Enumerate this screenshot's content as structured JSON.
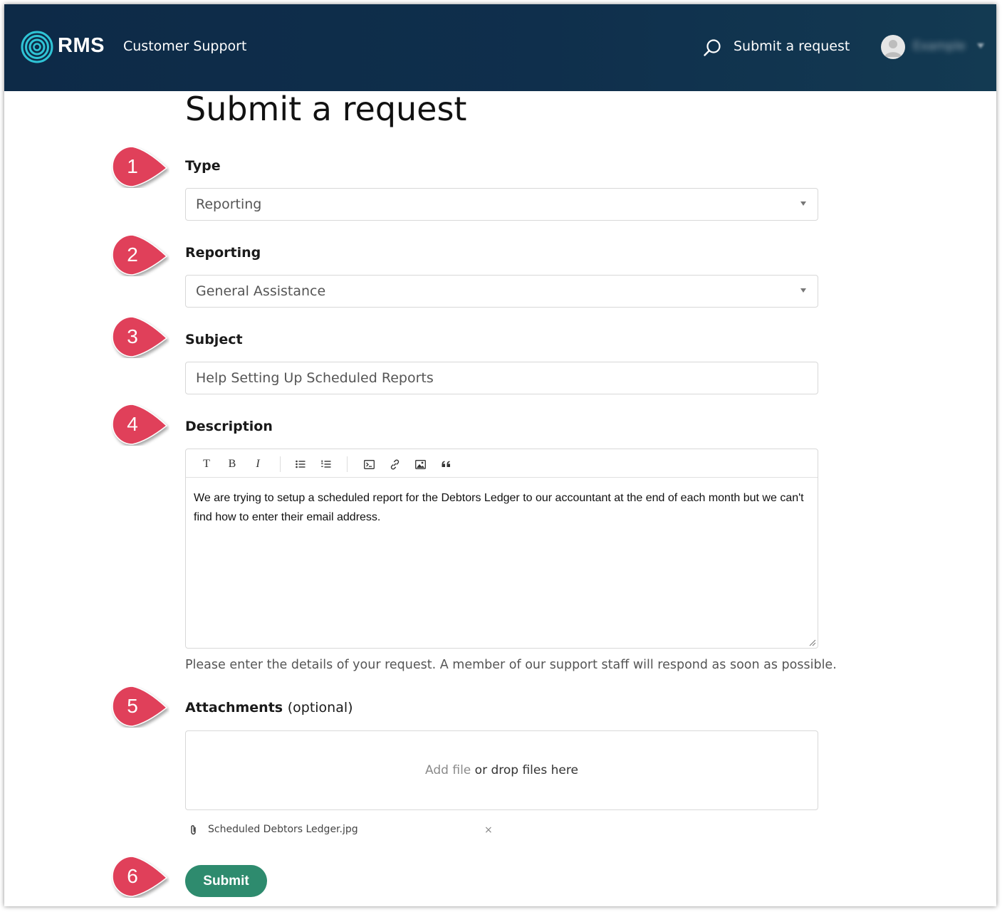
{
  "header": {
    "logo_text": "RMS",
    "site_title": "Customer Support",
    "submit_link": "Submit a request",
    "user_name": "Example",
    "icons": {
      "search": "search-icon",
      "user": "user-avatar-icon",
      "caret": "chevron-down-icon"
    },
    "colors": {
      "background": "#0f2f4c",
      "logo_ring": "#2fc4d6"
    }
  },
  "page": {
    "title": "Submit a request"
  },
  "form": {
    "type": {
      "label": "Type",
      "value": "Reporting"
    },
    "reporting": {
      "label": "Reporting",
      "value": "General Assistance"
    },
    "subject": {
      "label": "Subject",
      "value": "Help Setting Up Scheduled Reports"
    },
    "description": {
      "label": "Description",
      "toolbar": {
        "text": "T",
        "bold": "B",
        "italic": "I",
        "icons": [
          "bulleted-list-icon",
          "numbered-list-icon",
          "code-block-icon",
          "link-icon",
          "image-icon",
          "quote-icon"
        ]
      },
      "body": "We are trying to setup a scheduled report for the Debtors Ledger to our accountant at the end of each month but we can't find how to enter their email address.",
      "hint": "Please enter the details of your request. A member of our support staff will respond as soon as possible."
    },
    "attachments": {
      "label": "Attachments",
      "label_optional": "(optional)",
      "add_file": "Add file",
      "drop_text": "or drop files here",
      "files": [
        {
          "name": "Scheduled Debtors Ledger.jpg",
          "remove": "×"
        }
      ]
    },
    "submit_label": "Submit",
    "colors": {
      "submit": "#2e8b6e",
      "callout": "#e0405a"
    }
  },
  "callouts": [
    "1",
    "2",
    "3",
    "4",
    "5",
    "6"
  ]
}
